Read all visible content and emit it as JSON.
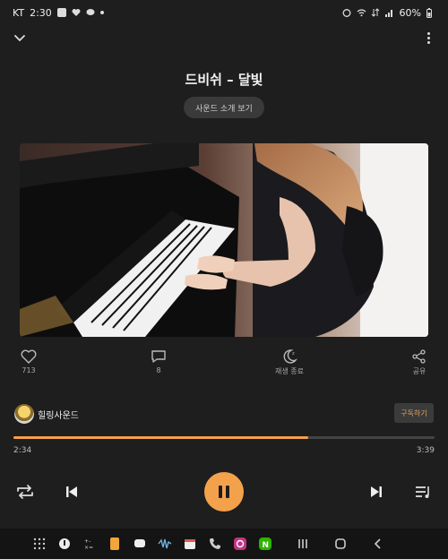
{
  "status": {
    "carrier": "KT",
    "time": "2:30",
    "battery": "60%"
  },
  "track": {
    "title": "드비쉬 – 달빛",
    "sound_button": "사운드 소개 보기"
  },
  "actions": {
    "like_count": "713",
    "comment_count": "8",
    "sleep_label": "재생 종료",
    "share_label": "공유"
  },
  "channel": {
    "name": "힐링사운드",
    "subscribe_label": "구독하기"
  },
  "player": {
    "current_time": "2:34",
    "total_time": "3:39",
    "progress": 0.7
  },
  "colors": {
    "accent": "#f4a14c",
    "background": "#1e1e1e"
  },
  "icons": {
    "collapse": "chevron-down-icon",
    "more": "more-vert-icon",
    "like": "heart-icon",
    "comment": "comment-icon",
    "sleep": "moon-icon",
    "share": "share-icon",
    "repeat": "repeat-icon",
    "prev": "skip-previous-icon",
    "play": "pause-icon",
    "next": "skip-next-icon",
    "playlist": "playlist-icon"
  }
}
